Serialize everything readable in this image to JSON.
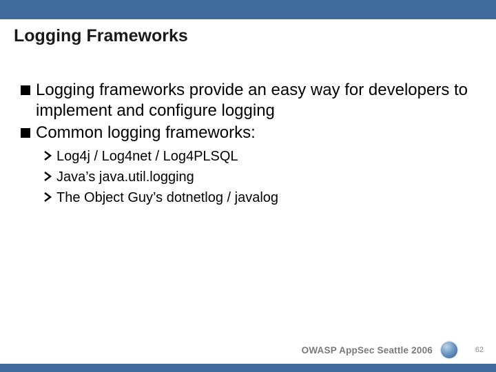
{
  "title": "Logging Frameworks",
  "bullets": [
    {
      "text": "Logging frameworks provide an easy way for developers to implement and configure logging"
    },
    {
      "text": "Common logging frameworks:"
    }
  ],
  "sub_bullets": [
    {
      "text": "Log4j / Log4net / Log4PLSQL"
    },
    {
      "text": "Java’s java.util.logging"
    },
    {
      "text": "The Object Guy’s dotnetlog / javalog"
    }
  ],
  "footer": {
    "text": "OWASP AppSec Seattle 2006",
    "page": "62"
  },
  "colors": {
    "bar": "#3f6a9a"
  }
}
